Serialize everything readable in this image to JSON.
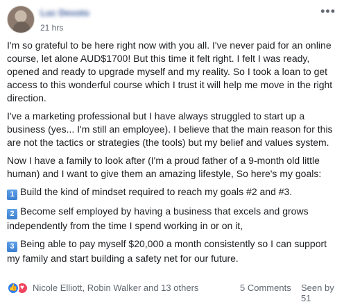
{
  "post": {
    "author": "Luc Devoto",
    "time": "21 hrs",
    "more_icon": "more-horizontal-icon",
    "paragraphs": [
      "I'm so grateful to be here right now with you all. I've never paid for an online course, let alone AUD$1700! But this time it felt right. I felt I was ready, opened and ready to upgrade myself and my reality. So I took a loan to get access to this wonderful course which I trust it will help me move in the right direction.",
      "I've a marketing professional but I have always struggled to start up a business (yes... I'm still an employee). I believe that the main reason for this are not the tactics or strategies (the tools) but my belief and values system.",
      "Now I have a family to look after (I'm a proud father of a 9-month old little human) and I want to give them an amazing lifestyle, So here's my goals:"
    ],
    "goals": [
      {
        "key": "1",
        "text": "Build the kind of mindset required to reach my goals #2 and #3."
      },
      {
        "key": "2",
        "text": "Become self employed by having a business that excels and grows independently from the time I spend working in or on it,"
      },
      {
        "key": "3",
        "text": "Being able to pay myself $20,000 a month consistently so I can support my family and start building a safety net for our future."
      }
    ]
  },
  "footer": {
    "reaction_icons": [
      "like-icon",
      "love-icon"
    ],
    "names": "Nicole Elliott, Robin Walker and 13 others",
    "comments": "5 Comments",
    "seen": "Seen by 51"
  },
  "colors": {
    "link": "#385898",
    "meta": "#606770",
    "like": "#2f7cf6",
    "love": "#f0445e",
    "keycap": "#4a8fdb"
  }
}
